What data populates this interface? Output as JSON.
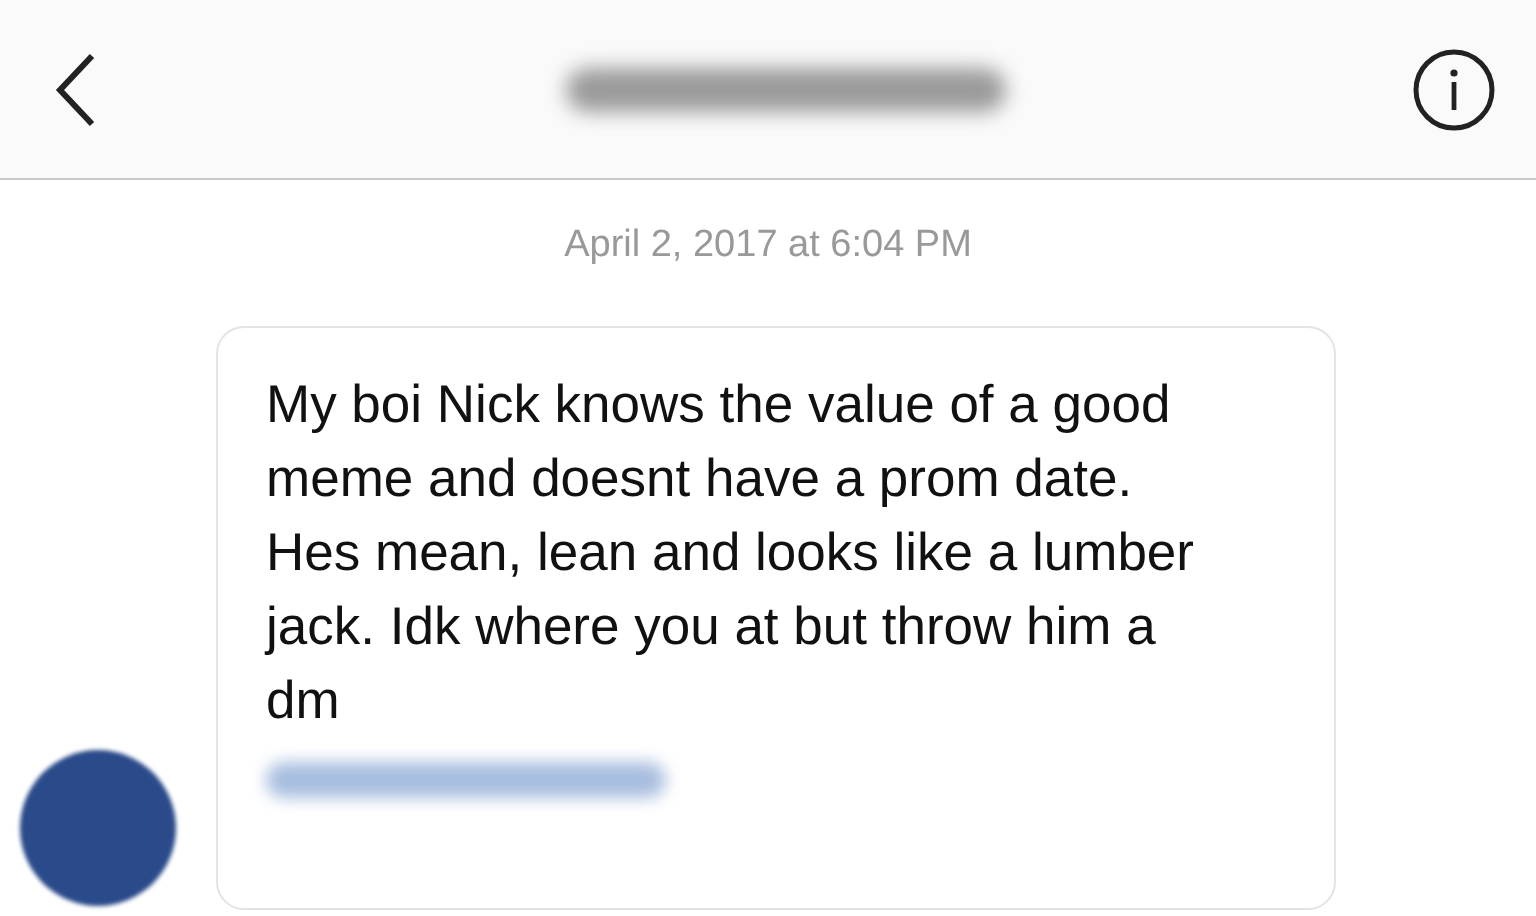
{
  "header": {
    "title_redacted": true
  },
  "timestamp": "April 2, 2017 at 6:04 PM",
  "message": {
    "text": "My boi Nick knows the value of a good meme and doesnt have a prom date. Hes mean, lean and looks like a lumber jack. Idk where you at but throw him a dm",
    "mention_redacted": true
  }
}
